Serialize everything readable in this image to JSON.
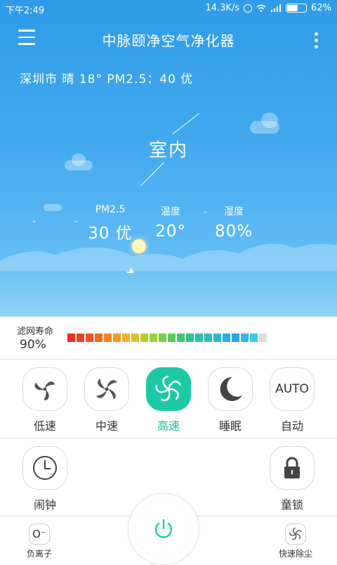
{
  "status": {
    "time": "下午2:49",
    "speed": "14.3K/s",
    "battery": "62%",
    "battery_level": 0.62
  },
  "app": {
    "title": "中脉颐净空气净化器"
  },
  "weather": {
    "text": "深圳市  晴  18°  PM2.5：40  优"
  },
  "indoor": {
    "label": "室内",
    "pm25_label": "PM2.5",
    "pm25_value": "30  优",
    "temp_label": "温度",
    "temp_value": "20°",
    "humidity_label": "湿度",
    "humidity_value": "80%"
  },
  "filter": {
    "label": "滤网寿命",
    "percent": "90%",
    "level": 0.9,
    "segment_colors": [
      "#e8311f",
      "#ea4020",
      "#ec5322",
      "#ef6a23",
      "#f28426",
      "#f49a28",
      "#f0b02a",
      "#d8c22c",
      "#b9cc32",
      "#98d03a",
      "#76cf48",
      "#56cb5c",
      "#3ec773",
      "#31c48b",
      "#2cc1a2",
      "#2bbfb9",
      "#2db7cf",
      "#2fa9df",
      "#31a2e4",
      "#35b5e8",
      "#3fc6ec",
      "#dddddd"
    ]
  },
  "modes": {
    "low": "低速",
    "mid": "中速",
    "high": "高速",
    "sleep": "睡眠",
    "auto": "自动",
    "auto_icon": "AUTO"
  },
  "extras": {
    "alarm": "闹钟",
    "lock": "童锁"
  },
  "bottom": {
    "anion": "负离子",
    "anion_icon": "O⁻",
    "quick": "快速除尘"
  },
  "colors": {
    "accent": "#1dc9a5",
    "sky": "#3aa5ed"
  }
}
